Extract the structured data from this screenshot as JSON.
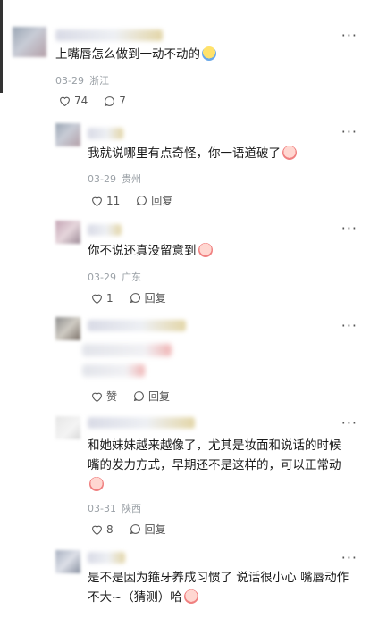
{
  "comments": [
    {
      "text": "上嘴唇怎么做到一动不动的",
      "date": "03-29",
      "location": "浙江",
      "likes": "74",
      "replies": "7"
    },
    {
      "text": "我就说哪里有点奇怪，你一语道破了",
      "date": "03-29",
      "location": "贵州",
      "likes": "11",
      "reply_label": "回复"
    },
    {
      "text": "你不说还真没留意到",
      "date": "03-29",
      "location": "广东",
      "likes": "1",
      "reply_label": "回复"
    },
    {
      "like_label": "赞",
      "reply_label": "回复"
    },
    {
      "text_lines": [
        "和她妹妹越来越像了，尤其是妆面和说话的时候",
        "嘴的发力方式，早期还不是这样的，可以正常动"
      ],
      "date": "03-31",
      "location": "陕西",
      "likes": "8",
      "reply_label": "回复"
    },
    {
      "text_lines": [
        "是不是因为箍牙养成习惯了 说话很小心 嘴唇动作",
        "不大~（猜测）哈"
      ],
      "partial_meta": "(猜测"
    }
  ],
  "more_glyph": "···",
  "icons": [
    "heart-icon",
    "comment-icon",
    "more-icon"
  ]
}
